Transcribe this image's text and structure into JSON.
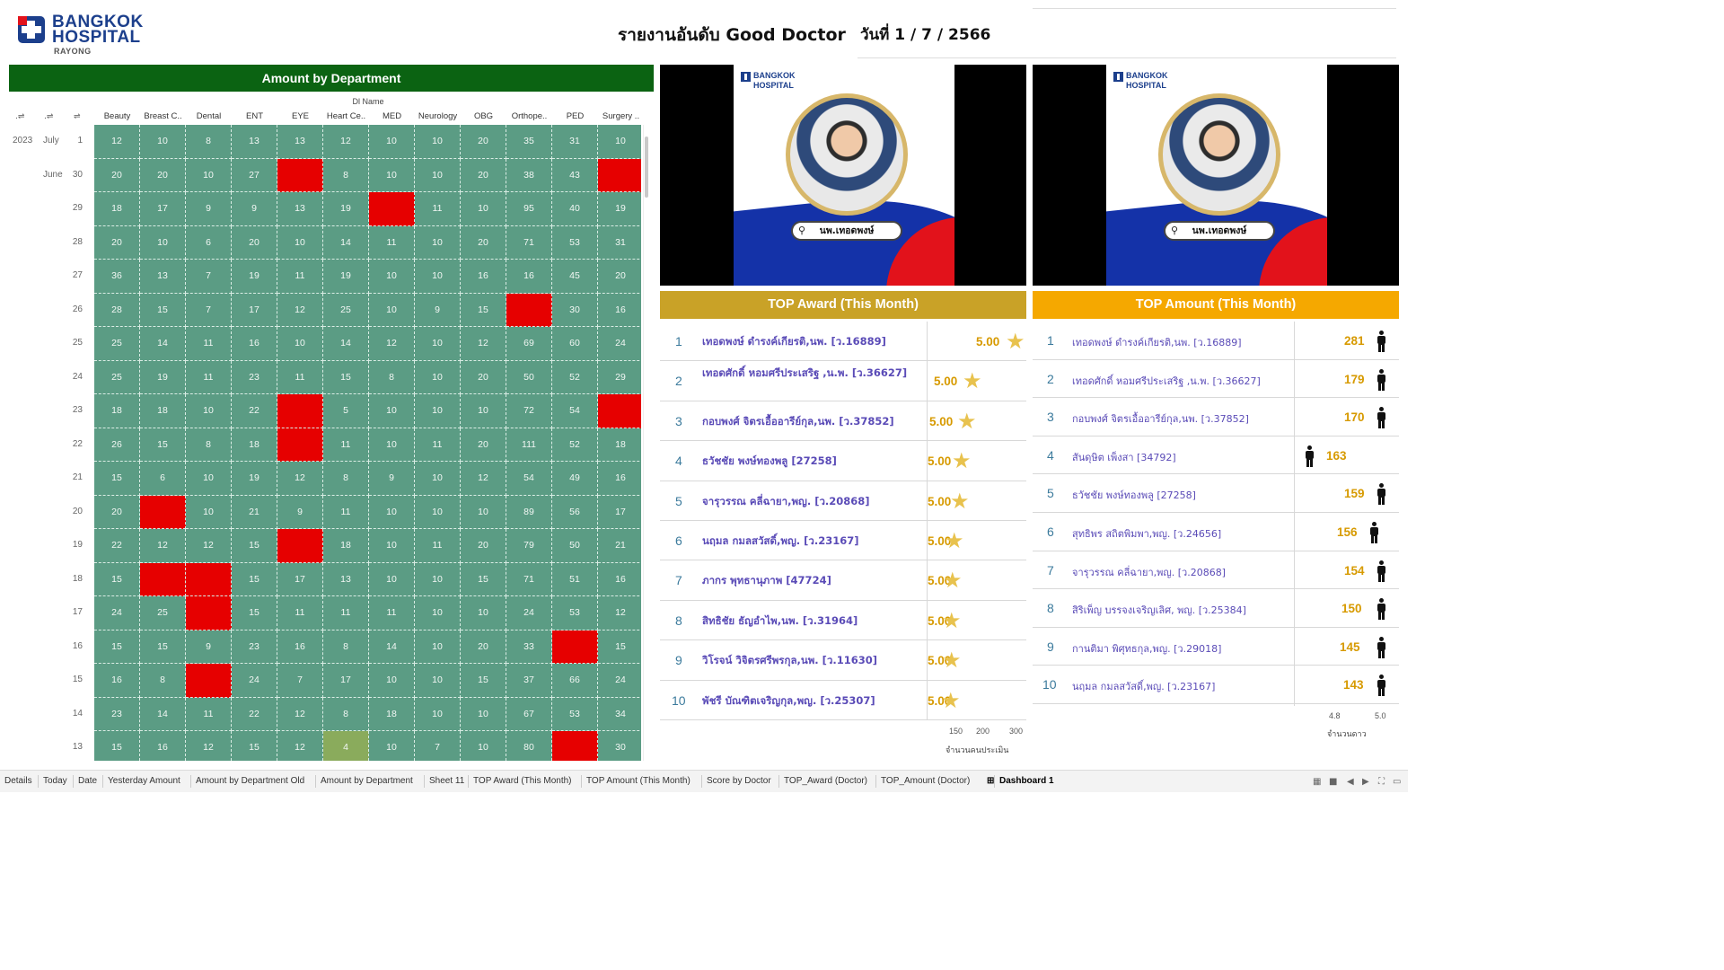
{
  "header": {
    "logo_line1": "BANGKOK",
    "logo_line2": "HOSPITAL",
    "logo_line3": "RAYONG",
    "title": "รายงานอันดับ Good Doctor",
    "date": "วันที่ 1 / 7 / 2566"
  },
  "heatmap": {
    "title": "Amount by Department",
    "column_group_label": "Dl Name",
    "columns": [
      "Beauty",
      "Breast C..",
      "Dental",
      "ENT",
      "EYE",
      "Heart Ce..",
      "MED",
      "Neurology",
      "OBG",
      "Orthope..",
      "PED",
      "Surgery .."
    ],
    "year_label": "2023",
    "rows": [
      {
        "month": "July",
        "day": "1",
        "values": [
          "12",
          "10",
          "8",
          "13",
          "13",
          "12",
          "10",
          "10",
          "20",
          "35",
          "31",
          "10"
        ],
        "flags": [
          "",
          "",
          "",
          "",
          "",
          "",
          "",
          "",
          "",
          "",
          "",
          ""
        ]
      },
      {
        "month": "June",
        "day": "30",
        "values": [
          "20",
          "20",
          "10",
          "27",
          "",
          "8",
          "10",
          "10",
          "20",
          "38",
          "43",
          ""
        ],
        "flags": [
          "",
          "",
          "",
          "",
          "red",
          "",
          "",
          "",
          "",
          "",
          "",
          "red"
        ]
      },
      {
        "month": "",
        "day": "29",
        "values": [
          "18",
          "17",
          "9",
          "9",
          "13",
          "19",
          "",
          "11",
          "10",
          "95",
          "40",
          "19"
        ],
        "flags": [
          "",
          "",
          "",
          "",
          "",
          "",
          "red",
          "",
          "",
          "",
          "",
          ""
        ]
      },
      {
        "month": "",
        "day": "28",
        "values": [
          "20",
          "10",
          "6",
          "20",
          "10",
          "14",
          "11",
          "10",
          "20",
          "71",
          "53",
          "31"
        ],
        "flags": [
          "",
          "",
          "",
          "",
          "",
          "",
          "",
          "",
          "",
          "",
          "",
          ""
        ]
      },
      {
        "month": "",
        "day": "27",
        "values": [
          "36",
          "13",
          "7",
          "19",
          "11",
          "19",
          "10",
          "10",
          "16",
          "16",
          "45",
          "20"
        ],
        "flags": [
          "",
          "",
          "",
          "",
          "",
          "",
          "",
          "",
          "",
          "",
          "",
          ""
        ]
      },
      {
        "month": "",
        "day": "26",
        "values": [
          "28",
          "15",
          "7",
          "17",
          "12",
          "25",
          "10",
          "9",
          "15",
          "",
          "30",
          "16"
        ],
        "flags": [
          "",
          "",
          "",
          "",
          "",
          "",
          "",
          "",
          "",
          "red",
          "",
          ""
        ]
      },
      {
        "month": "",
        "day": "25",
        "values": [
          "25",
          "14",
          "11",
          "16",
          "10",
          "14",
          "12",
          "10",
          "12",
          "69",
          "60",
          "24"
        ],
        "flags": [
          "",
          "",
          "",
          "",
          "",
          "",
          "",
          "",
          "",
          "",
          "",
          ""
        ]
      },
      {
        "month": "",
        "day": "24",
        "values": [
          "25",
          "19",
          "11",
          "23",
          "11",
          "15",
          "8",
          "10",
          "20",
          "50",
          "52",
          "29"
        ],
        "flags": [
          "",
          "",
          "",
          "",
          "",
          "",
          "",
          "",
          "",
          "",
          "",
          ""
        ]
      },
      {
        "month": "",
        "day": "23",
        "values": [
          "18",
          "18",
          "10",
          "22",
          "",
          "5",
          "10",
          "10",
          "10",
          "72",
          "54",
          ""
        ],
        "flags": [
          "",
          "",
          "",
          "",
          "red",
          "",
          "",
          "",
          "",
          "",
          "",
          "red"
        ]
      },
      {
        "month": "",
        "day": "22",
        "values": [
          "26",
          "15",
          "8",
          "18",
          "",
          "11",
          "10",
          "11",
          "20",
          "111",
          "52",
          "18"
        ],
        "flags": [
          "",
          "",
          "",
          "",
          "red",
          "",
          "",
          "",
          "",
          "",
          "",
          ""
        ]
      },
      {
        "month": "",
        "day": "21",
        "values": [
          "15",
          "6",
          "10",
          "19",
          "12",
          "8",
          "9",
          "10",
          "12",
          "54",
          "49",
          "16"
        ],
        "flags": [
          "",
          "",
          "",
          "",
          "",
          "",
          "",
          "",
          "",
          "",
          "",
          ""
        ]
      },
      {
        "month": "",
        "day": "20",
        "values": [
          "20",
          "",
          "10",
          "21",
          "9",
          "11",
          "10",
          "10",
          "10",
          "89",
          "56",
          "17"
        ],
        "flags": [
          "",
          "red",
          "",
          "",
          "",
          "",
          "",
          "",
          "",
          "",
          "",
          ""
        ]
      },
      {
        "month": "",
        "day": "19",
        "values": [
          "22",
          "12",
          "12",
          "15",
          "",
          "18",
          "10",
          "11",
          "20",
          "79",
          "50",
          "21"
        ],
        "flags": [
          "",
          "",
          "",
          "",
          "red",
          "",
          "",
          "",
          "",
          "",
          "",
          ""
        ]
      },
      {
        "month": "",
        "day": "18",
        "values": [
          "15",
          "",
          "",
          "15",
          "17",
          "13",
          "10",
          "10",
          "15",
          "71",
          "51",
          "16"
        ],
        "flags": [
          "",
          "red",
          "red",
          "",
          "",
          "",
          "",
          "",
          "",
          "",
          "",
          ""
        ]
      },
      {
        "month": "",
        "day": "17",
        "values": [
          "24",
          "25",
          "",
          "15",
          "11",
          "11",
          "11",
          "10",
          "10",
          "24",
          "53",
          "12"
        ],
        "flags": [
          "",
          "",
          "red",
          "",
          "",
          "",
          "",
          "",
          "",
          "",
          "",
          ""
        ]
      },
      {
        "month": "",
        "day": "16",
        "values": [
          "15",
          "15",
          "9",
          "23",
          "16",
          "8",
          "14",
          "10",
          "20",
          "33",
          "",
          "15"
        ],
        "flags": [
          "",
          "",
          "",
          "",
          "",
          "",
          "",
          "",
          "",
          "",
          "red",
          ""
        ]
      },
      {
        "month": "",
        "day": "15",
        "values": [
          "16",
          "8",
          "",
          "24",
          "7",
          "17",
          "10",
          "10",
          "15",
          "37",
          "66",
          "24"
        ],
        "flags": [
          "",
          "",
          "red",
          "",
          "",
          "",
          "",
          "",
          "",
          "",
          "",
          ""
        ]
      },
      {
        "month": "",
        "day": "14",
        "values": [
          "23",
          "14",
          "11",
          "22",
          "12",
          "8",
          "18",
          "10",
          "10",
          "67",
          "53",
          "34"
        ],
        "flags": [
          "",
          "",
          "",
          "",
          "",
          "",
          "",
          "",
          "",
          "",
          "",
          ""
        ]
      },
      {
        "month": "",
        "day": "13",
        "values": [
          "15",
          "16",
          "12",
          "15",
          "12",
          "4",
          "10",
          "7",
          "10",
          "80",
          "",
          "30"
        ],
        "flags": [
          "",
          "",
          "",
          "",
          "",
          "olive",
          "",
          "",
          "",
          "",
          "red",
          ""
        ]
      }
    ],
    "colors": {
      "base": "#5b9c84",
      "red": "#e60000",
      "olive": "#8aab5c",
      "title_bg": "#0b6312"
    }
  },
  "doctor_cards": [
    {
      "name_tag": "นพ.เทอดพงษ์"
    },
    {
      "name_tag": "นพ.เทอดพงษ์"
    }
  ],
  "top_award": {
    "title": "TOP Award (This Month)",
    "title_color": "#c9a227",
    "rows": [
      {
        "rank": "1",
        "name": "เทอดพงษ์ ดำรงค์เกียรติ,นพ. [ว.16889]",
        "value": "5.00"
      },
      {
        "rank": "2",
        "name": "เทอดศักดิ์ หอมศรีประเสริฐ ,น.พ. [ว.36627]",
        "value": "5.00"
      },
      {
        "rank": "3",
        "name": "กอบพงศ์ จิตรเอื้ออารีย์กุล,นพ. [ว.37852]",
        "value": "5.00"
      },
      {
        "rank": "4",
        "name": "ธวัชชัย พงษ์ทองพลู [27258]",
        "value": "5.00"
      },
      {
        "rank": "5",
        "name": "จารุวรรณ คลี่ฉายา,พญ. [ว.20868]",
        "value": "5.00"
      },
      {
        "rank": "6",
        "name": "นฤมล กมลสวัสดิ์,พญ. [ว.23167]",
        "value": "5.00"
      },
      {
        "rank": "7",
        "name": "ภากร พุทธานุภาพ [47724]",
        "value": "5.00"
      },
      {
        "rank": "8",
        "name": "สิทธิชัย ธัญอำไพ,นพ. [ว.31964]",
        "value": "5.00"
      },
      {
        "rank": "9",
        "name": "วิโรจน์ วิจิตรศรีพรกุล,นพ. [ว.11630]",
        "value": "5.00"
      },
      {
        "rank": "10",
        "name": "พัชรี บัณฑิตเจริญกุล,พญ. [ว.25307]",
        "value": "5.00"
      }
    ],
    "axis_ticks": [
      "150",
      "200",
      "300"
    ],
    "axis_title": "จำนวนคนประเมิน"
  },
  "top_amount": {
    "title": "TOP Amount (This Month)",
    "title_color": "#f5a800",
    "rows": [
      {
        "rank": "1",
        "name": "เทอดพงษ์ ดำรงค์เกียรติ,นพ. [ว.16889]",
        "value": "281"
      },
      {
        "rank": "2",
        "name": "เทอดศักดิ์ หอมศรีประเสริฐ ,น.พ. [ว.36627]",
        "value": "179"
      },
      {
        "rank": "3",
        "name": "กอบพงศ์ จิตรเอื้ออารีย์กุล,นพ. [ว.37852]",
        "value": "170"
      },
      {
        "rank": "4",
        "name": "สันดุษิต เพ็งสา [34792]",
        "value": "163"
      },
      {
        "rank": "5",
        "name": "ธวัชชัย พงษ์ทองพลู [27258]",
        "value": "159"
      },
      {
        "rank": "6",
        "name": "สุทธิพร สถิตพิมพา,พญ. [ว.24656]",
        "value": "156"
      },
      {
        "rank": "7",
        "name": "จารุวรรณ คลี่ฉายา,พญ. [ว.20868]",
        "value": "154"
      },
      {
        "rank": "8",
        "name": "สิริเพ็ญ บรรจงเจริญเลิศ, พญ. [ว.25384]",
        "value": "150"
      },
      {
        "rank": "9",
        "name": "กานติมา พิศุทธกุล,พญ. [ว.29018]",
        "value": "145"
      },
      {
        "rank": "10",
        "name": "นฤมล กมลสวัสดิ์,พญ. [ว.23167]",
        "value": "143"
      }
    ],
    "axis_ticks": [
      "4.8",
      "5.0"
    ],
    "axis_title": "จำนวนดาว"
  },
  "tabs": [
    {
      "label": "Details"
    },
    {
      "label": "Today"
    },
    {
      "label": "Date"
    },
    {
      "label": "Yesterday Amount"
    },
    {
      "label": "Amount by Department Old"
    },
    {
      "label": "Amount by Department"
    },
    {
      "label": "Sheet 11"
    },
    {
      "label": "TOP Award (This Month)"
    },
    {
      "label": "TOP Amount (This Month)"
    },
    {
      "label": "Score by Doctor"
    },
    {
      "label": "TOP_Award (Doctor)"
    },
    {
      "label": "TOP_Amount (Doctor)"
    },
    {
      "label": "Dashboard 1",
      "active": true
    }
  ]
}
